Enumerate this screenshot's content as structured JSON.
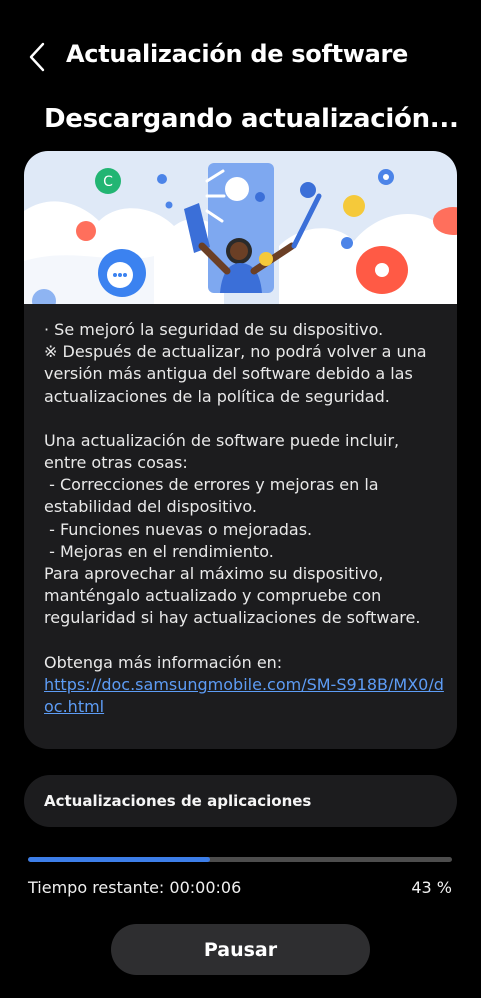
{
  "header": {
    "back_icon": "chevron-left-icon",
    "title": "Actualización de software"
  },
  "status": "Descargando actualización...",
  "banner": {
    "illustration": "software-update-illustration"
  },
  "notes": {
    "security_line": "· Se mejoró la seguridad de su dispositivo.",
    "warning": "※ Después de actualizar, no podrá volver a una versión más antigua del software debido a las actualizaciones de la política de seguridad.",
    "intro": "Una actualización de software puede incluir, entre otras cosas:",
    "items": [
      " - Correcciones de errores y mejoras en la estabilidad del dispositivo.",
      " - Funciones nuevas o mejoradas.",
      " - Mejoras en el rendimiento."
    ],
    "advice": "Para aprovechar al máximo su dispositivo, manténgalo actualizado y compruebe con regularidad si hay actualizaciones de software.",
    "more_info_label": "Obtenga más información en:",
    "more_info_link": "https://doc.samsungmobile.com/SM-S918B/MX0/doc.html"
  },
  "apps_updates_label": "Actualizaciones de aplicaciones",
  "progress": {
    "fraction": 0.43,
    "remaining_label": "Tiempo restante: 00:00:06",
    "percent_label": "43 %"
  },
  "pause_button_label": "Pausar",
  "colors": {
    "background": "#000000",
    "card": "#1c1c1e",
    "progress_fill": "#3d7ee8",
    "link": "#5d9cf5",
    "button": "#2e2e30"
  }
}
